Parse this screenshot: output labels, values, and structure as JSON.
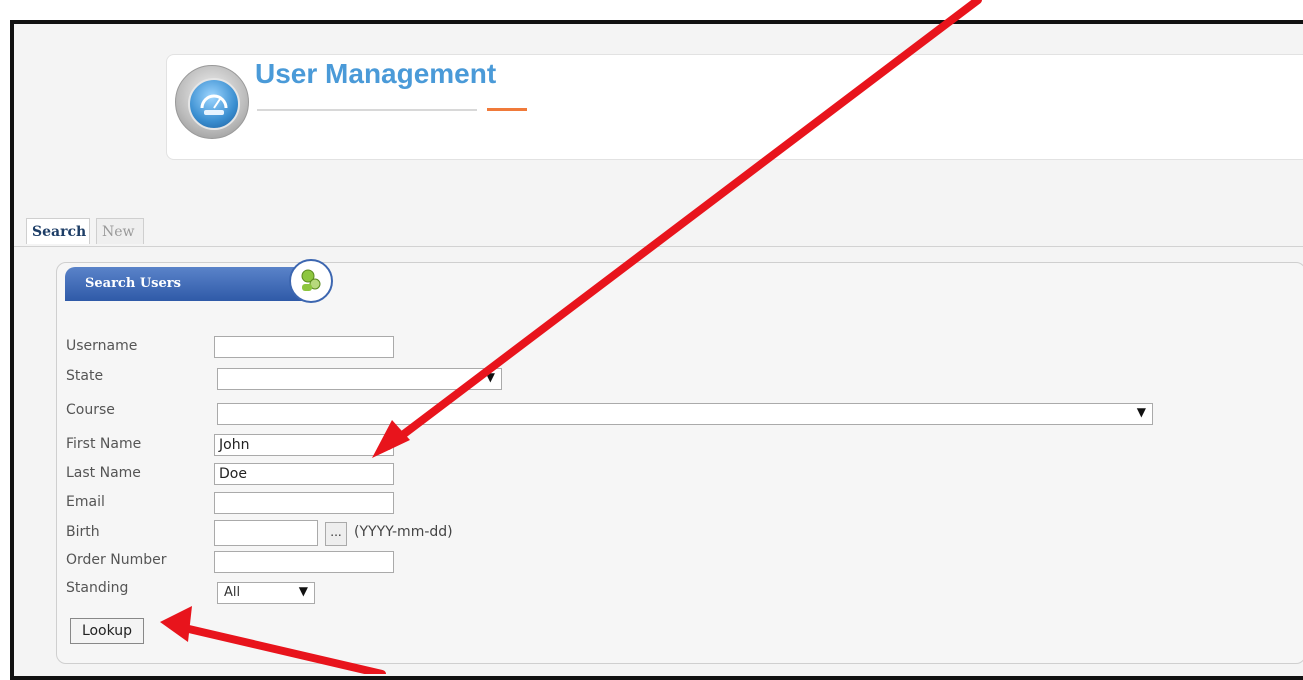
{
  "header": {
    "title": "User Management"
  },
  "tabs": [
    {
      "label": "Search",
      "active": true
    },
    {
      "label": "New",
      "active": false
    }
  ],
  "panel": {
    "title": "Search Users"
  },
  "form": {
    "username": {
      "label": "Username",
      "value": ""
    },
    "state": {
      "label": "State",
      "value": ""
    },
    "course": {
      "label": "Course",
      "value": ""
    },
    "first_name": {
      "label": "First Name",
      "value": "John"
    },
    "last_name": {
      "label": "Last Name",
      "value": "Doe"
    },
    "email": {
      "label": "Email",
      "value": ""
    },
    "birth": {
      "label": "Birth",
      "value": "",
      "button": "...",
      "hint": "(YYYY-mm-dd)"
    },
    "order_number": {
      "label": "Order Number",
      "value": ""
    },
    "standing": {
      "label": "Standing",
      "value": "All"
    }
  },
  "actions": {
    "lookup_label": "Lookup"
  },
  "colors": {
    "annotation_arrow": "#e8141c",
    "title": "#4a9ad8",
    "panel_header": "#2f5aa8"
  },
  "icons": {
    "header": "speedometer-icon",
    "panel": "users-search-icon",
    "dropdown": "dropdown-arrow-icon"
  }
}
